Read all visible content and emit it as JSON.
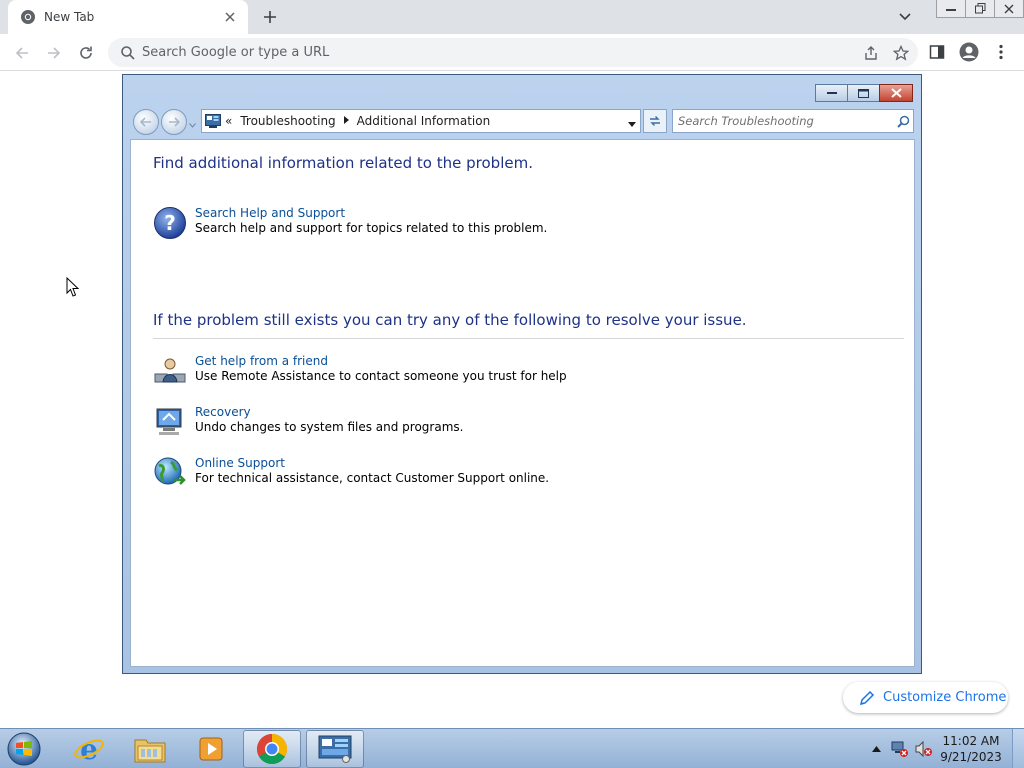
{
  "browser": {
    "tab_title": "New Tab",
    "omnibox_placeholder": "Search Google or type a URL",
    "customize_label": "Customize Chrome"
  },
  "window": {
    "breadcrumb": {
      "overflow": "«",
      "items": [
        "Troubleshooting",
        "Additional Information"
      ]
    },
    "search_placeholder": "Search Troubleshooting",
    "section1_heading": "Find additional information related to the problem.",
    "section2_heading": "If the problem still exists you can try any of the following to resolve your issue.",
    "links": [
      {
        "title": "Search Help and Support",
        "description": "Search help and support for topics related to this problem.",
        "icon": "help-icon"
      },
      {
        "title": "Get help from a friend",
        "description": "Use Remote Assistance to contact someone you trust for help",
        "icon": "remote-assistance-icon"
      },
      {
        "title": "Recovery",
        "description": "Undo changes to system files and programs.",
        "icon": "recovery-icon"
      },
      {
        "title": "Online Support",
        "description": "For technical assistance, contact Customer Support online.",
        "icon": "online-support-icon"
      }
    ]
  },
  "taskbar": {
    "time": "11:02 AM",
    "date": "9/21/2023",
    "items": [
      "internet-explorer-icon",
      "file-explorer-icon",
      "media-player-icon",
      "chrome-icon",
      "control-panel-icon"
    ]
  },
  "colors": {
    "link": "#0a4f95",
    "heading": "#1e3287",
    "chrome_accent": "#1a73e8"
  }
}
